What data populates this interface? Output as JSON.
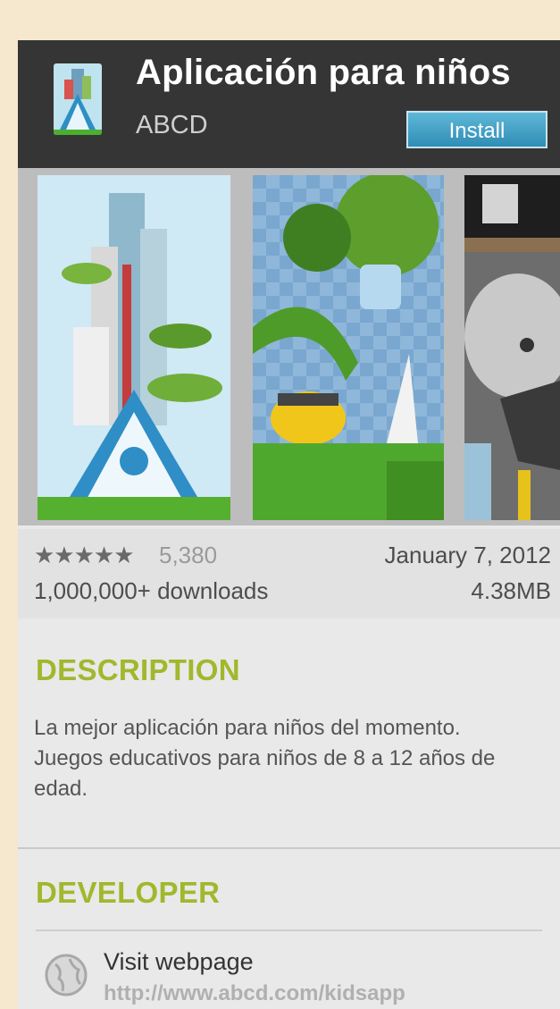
{
  "app": {
    "title": "Aplicación para niños",
    "publisher": "ABCD",
    "install_label": "Install",
    "icon": "app-logo-icon"
  },
  "screenshots": [
    {
      "name": "tower-city-screenshot"
    },
    {
      "name": "green-hills-screenshot"
    },
    {
      "name": "character-room-screenshot"
    }
  ],
  "meta": {
    "stars": "★★★★★",
    "rating_value": 4.5,
    "rating_count": "5,380",
    "downloads": "1,000,000+ downloads",
    "date": "January 7, 2012",
    "size": "4.38MB"
  },
  "description": {
    "heading": "DESCRIPTION",
    "text": "La mejor aplicación para niños del momento. Juegos educativos para niños de 8 a 12 años de edad."
  },
  "developer": {
    "heading": "DEVELOPER",
    "visit_label": "Visit webpage",
    "url": "http://www.abcd.com/kidsapp",
    "icon": "globe-icon"
  },
  "colors": {
    "accent": "#a0b82c",
    "header_bg": "#353535",
    "install_button": "#3fa0c8",
    "page_bg": "#f6e7cf"
  }
}
